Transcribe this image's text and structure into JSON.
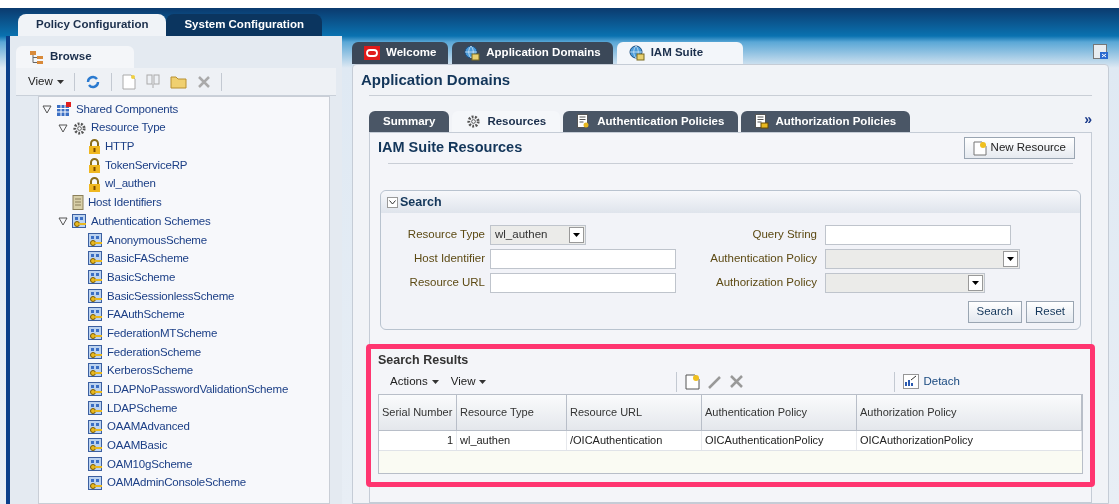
{
  "main_tabs": [
    {
      "label": "Policy Configuration",
      "selected": true
    },
    {
      "label": "System Configuration",
      "selected": false
    }
  ],
  "browse": {
    "tab": "Browse",
    "view_menu": "View"
  },
  "tree": [
    {
      "label": "Shared Components",
      "kind": "components",
      "expanded": true,
      "children": [
        {
          "label": "Resource Type",
          "kind": "gear",
          "expanded": true,
          "children": [
            {
              "label": "HTTP",
              "kind": "lock"
            },
            {
              "label": "TokenServiceRP",
              "kind": "lock"
            },
            {
              "label": "wl_authen",
              "kind": "lock"
            }
          ]
        },
        {
          "label": "Host Identifiers",
          "kind": "server"
        },
        {
          "label": "Authentication Schemes",
          "kind": "scheme",
          "expanded": true,
          "children": [
            {
              "label": "AnonymousScheme",
              "kind": "scheme"
            },
            {
              "label": "BasicFAScheme",
              "kind": "scheme"
            },
            {
              "label": "BasicScheme",
              "kind": "scheme"
            },
            {
              "label": "BasicSessionlessScheme",
              "kind": "scheme"
            },
            {
              "label": "FAAuthScheme",
              "kind": "scheme"
            },
            {
              "label": "FederationMTScheme",
              "kind": "scheme"
            },
            {
              "label": "FederationScheme",
              "kind": "scheme"
            },
            {
              "label": "KerberosScheme",
              "kind": "scheme"
            },
            {
              "label": "LDAPNoPasswordValidationScheme",
              "kind": "scheme"
            },
            {
              "label": "LDAPScheme",
              "kind": "scheme"
            },
            {
              "label": "OAAMAdvanced",
              "kind": "scheme"
            },
            {
              "label": "OAAMBasic",
              "kind": "scheme"
            },
            {
              "label": "OAM10gScheme",
              "kind": "scheme"
            },
            {
              "label": "OAMAdminConsoleScheme",
              "kind": "scheme"
            }
          ]
        }
      ]
    }
  ],
  "doc_tabs": [
    {
      "label": "Welcome",
      "kind": "oracle",
      "selected": false
    },
    {
      "label": "Application Domains",
      "kind": "globe",
      "selected": false
    },
    {
      "label": "IAM Suite",
      "kind": "globe",
      "selected": true
    }
  ],
  "page_title": "Application Domains",
  "sub_tabs": [
    {
      "label": "Summary",
      "kind": "none",
      "selected": false
    },
    {
      "label": "Resources",
      "kind": "gear",
      "selected": true
    },
    {
      "label": "Authentication Policies",
      "kind": "authn",
      "selected": false
    },
    {
      "label": "Authorization Policies",
      "kind": "authz",
      "selected": false
    }
  ],
  "more_tabs": "»",
  "section_title": "IAM Suite Resources",
  "new_button": "New Resource",
  "search": {
    "title": "Search",
    "expanded": true,
    "fields": [
      {
        "label": "Resource Type",
        "kind": "select",
        "value": "wl_authen"
      },
      {
        "label": "Host Identifier",
        "kind": "text"
      },
      {
        "label": "Resource URL",
        "kind": "text"
      },
      {
        "label": "Query String",
        "kind": "text"
      },
      {
        "label": "Authentication Policy",
        "kind": "select"
      },
      {
        "label": "Authorization Policy",
        "kind": "select"
      }
    ],
    "buttons": [
      "Search",
      "Reset"
    ]
  },
  "results": {
    "title": "Search Results",
    "menus": [
      "Actions",
      "View"
    ],
    "detach": "Detach",
    "columns": [
      "Serial Number",
      "Resource Type",
      "Resource URL",
      "Authentication Policy",
      "Authorization Policy"
    ],
    "rows": [
      [
        "1",
        "wl_authen",
        "/OICAuthentication",
        "OICAuthenticationPolicy",
        "OICAuthorizationPolicy"
      ]
    ]
  }
}
